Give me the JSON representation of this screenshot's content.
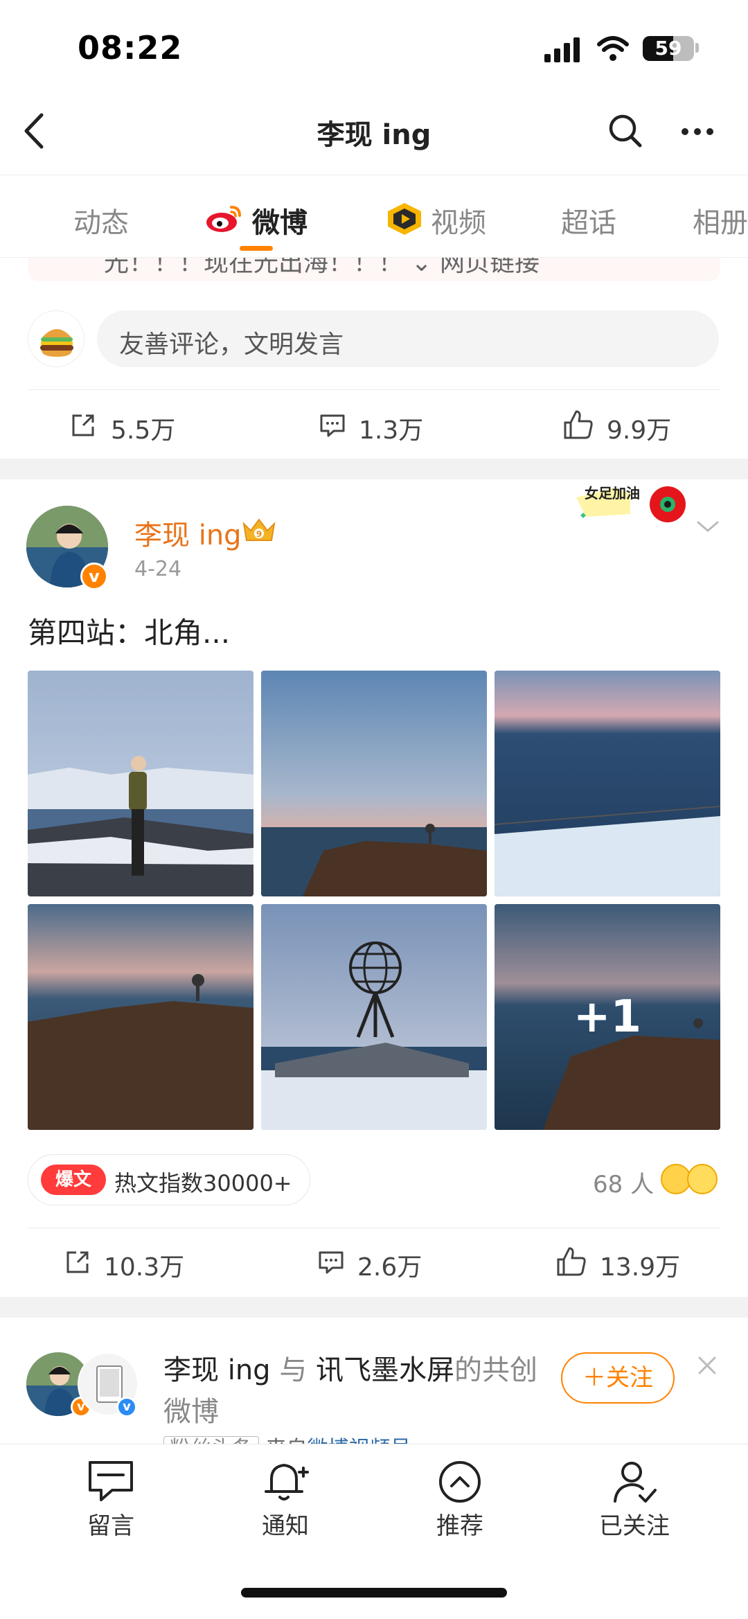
{
  "status_bar": {
    "time": "08:22",
    "battery": "59"
  },
  "nav": {
    "title": "李现 ing"
  },
  "tabs": [
    {
      "label": "动态"
    },
    {
      "label": "微博"
    },
    {
      "label": "视频"
    },
    {
      "label": "超话"
    },
    {
      "label": "相册"
    }
  ],
  "prev_post": {
    "strip_text": "光！！！现在光出海！！！   ⌄ 网页链接",
    "comment_placeholder": "友善评论，文明发言",
    "actions": {
      "repost": "5.5万",
      "comment": "1.3万",
      "like": "9.9万"
    }
  },
  "post": {
    "author": "李现 ing",
    "date": "4-24",
    "text": "第四站：北角...",
    "sticker_text": "女足加油",
    "more_photos": "+1",
    "hot_badge": "爆文",
    "hot_index": "热文指数30000+",
    "reactions_count": "68 人",
    "actions": {
      "repost": "10.3万",
      "comment": "2.6万",
      "like": "13.9万"
    }
  },
  "recommendation": {
    "user": "李现 ing",
    "connector": "与",
    "partner": "讯飞墨水屏",
    "suffix": "的共创微博",
    "follow_label": "＋关注",
    "tag": "粉丝头条",
    "source_prefix": "来自",
    "source": "微博视频号"
  },
  "bottom_nav": [
    {
      "label": "留言"
    },
    {
      "label": "通知"
    },
    {
      "label": "推荐"
    },
    {
      "label": "已关注"
    }
  ]
}
